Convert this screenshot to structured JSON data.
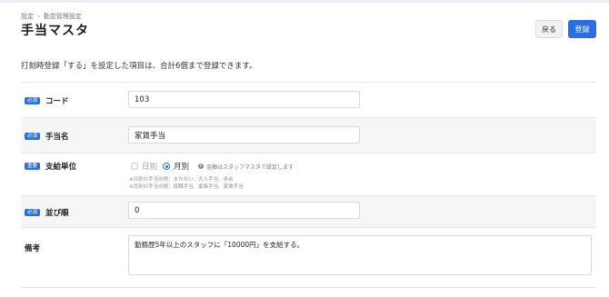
{
  "breadcrumb": {
    "items": [
      "設定",
      "勤怠管理設定"
    ],
    "separator": "›"
  },
  "page": {
    "title": "手当マスタ"
  },
  "actions": {
    "back_label": "戻る",
    "save_label": "登録"
  },
  "intro_text": "打刻時登録「する」を設定した項目は、合計6個まで登録できます。",
  "form": {
    "code": {
      "badge": "必須",
      "label": "コード",
      "value": "103"
    },
    "name": {
      "badge": "必須",
      "label": "手当名",
      "value": "家賃手当"
    },
    "unit": {
      "badge": "重要",
      "label": "支給単位",
      "options": [
        "日別",
        "月別"
      ],
      "selected": "月別",
      "info": "金額はスタッフマスタで設定します",
      "hint_daily": "※日別の手当の例：まかない、大入手当、歩合",
      "hint_monthly": "※月別の手当の例：役職手当、家族手当、家賃手当"
    },
    "order": {
      "badge": "必須",
      "label": "並び順",
      "value": "0"
    },
    "note": {
      "label": "備考",
      "value": "勤務歴5年以上のスタッフに「10000円」を支給する。"
    }
  },
  "colors": {
    "accent": "#2a6fe0",
    "row_grey": "#f5f6f7"
  },
  "icons": {
    "info": "info-icon"
  }
}
